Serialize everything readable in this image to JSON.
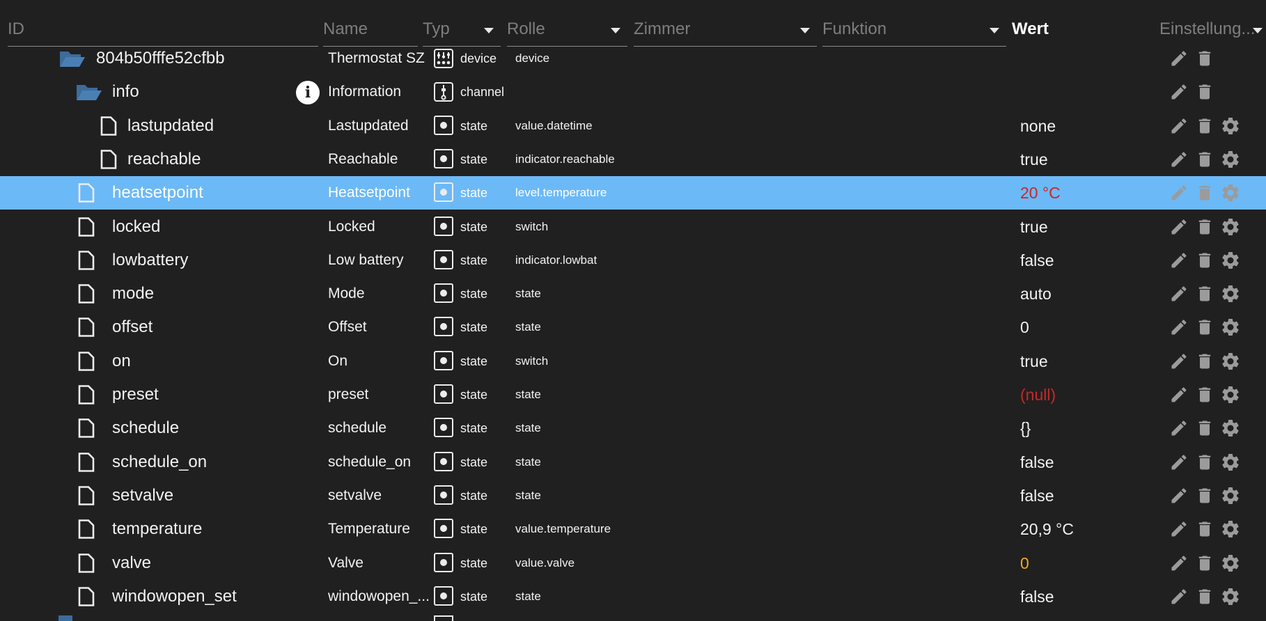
{
  "columns": {
    "id": "ID",
    "name": "Name",
    "typ": "Typ",
    "rolle": "Rolle",
    "zimmer": "Zimmer",
    "funktion": "Funktion",
    "wert": "Wert",
    "einstellung": "Einstellung..."
  },
  "rows": [
    {
      "id": "804b50fffe52cfbb",
      "name": "Thermostat SZ",
      "type": "device",
      "role": "device",
      "value": "",
      "icon": "folder-open-icon",
      "level": 0,
      "actions": [
        "edit-icon",
        "delete-icon"
      ]
    },
    {
      "id": "info",
      "name": "Information",
      "type": "channel",
      "role": "",
      "value": "",
      "icon": "folder-open-icon",
      "level": 1,
      "info_icon": "info-icon",
      "actions": [
        "edit-icon",
        "delete-icon"
      ]
    },
    {
      "id": "lastupdated",
      "name": "Lastupdated",
      "type": "state",
      "role": "value.datetime",
      "value": "none",
      "icon": "file-icon",
      "level": 2,
      "actions": [
        "edit-icon",
        "delete-icon",
        "gear-icon"
      ]
    },
    {
      "id": "reachable",
      "name": "Reachable",
      "type": "state",
      "role": "indicator.reachable",
      "value": "true",
      "icon": "file-icon",
      "level": 2,
      "actions": [
        "edit-icon",
        "delete-icon",
        "gear-icon"
      ]
    },
    {
      "id": "heatsetpoint",
      "name": "Heatsetpoint",
      "type": "state",
      "role": "level.temperature",
      "value": "20 °C",
      "value_color": "red",
      "selected": true,
      "icon": "file-icon",
      "level": 1,
      "actions": [
        "edit-icon",
        "delete-icon",
        "gear-icon"
      ]
    },
    {
      "id": "locked",
      "name": "Locked",
      "type": "state",
      "role": "switch",
      "value": "true",
      "icon": "file-icon",
      "level": 1,
      "actions": [
        "edit-icon",
        "delete-icon",
        "gear-icon"
      ]
    },
    {
      "id": "lowbattery",
      "name": "Low battery",
      "type": "state",
      "role": "indicator.lowbat",
      "value": "false",
      "icon": "file-icon",
      "level": 1,
      "actions": [
        "edit-icon",
        "delete-icon",
        "gear-icon"
      ]
    },
    {
      "id": "mode",
      "name": "Mode",
      "type": "state",
      "role": "state",
      "value": "auto",
      "icon": "file-icon",
      "level": 1,
      "actions": [
        "edit-icon",
        "delete-icon",
        "gear-icon"
      ]
    },
    {
      "id": "offset",
      "name": "Offset",
      "type": "state",
      "role": "state",
      "value": "0",
      "icon": "file-icon",
      "level": 1,
      "actions": [
        "edit-icon",
        "delete-icon",
        "gear-icon"
      ]
    },
    {
      "id": "on",
      "name": "On",
      "type": "state",
      "role": "switch",
      "value": "true",
      "icon": "file-icon",
      "level": 1,
      "actions": [
        "edit-icon",
        "delete-icon",
        "gear-icon"
      ]
    },
    {
      "id": "preset",
      "name": "preset",
      "type": "state",
      "role": "state",
      "value": "(null)",
      "value_color": "red",
      "icon": "file-icon",
      "level": 1,
      "actions": [
        "edit-icon",
        "delete-icon",
        "gear-icon"
      ]
    },
    {
      "id": "schedule",
      "name": "schedule",
      "type": "state",
      "role": "state",
      "value": "{}",
      "icon": "file-icon",
      "level": 1,
      "actions": [
        "edit-icon",
        "delete-icon",
        "gear-icon"
      ]
    },
    {
      "id": "schedule_on",
      "name": "schedule_on",
      "type": "state",
      "role": "state",
      "value": "false",
      "icon": "file-icon",
      "level": 1,
      "actions": [
        "edit-icon",
        "delete-icon",
        "gear-icon"
      ]
    },
    {
      "id": "setvalve",
      "name": "setvalve",
      "type": "state",
      "role": "state",
      "value": "false",
      "icon": "file-icon",
      "level": 1,
      "actions": [
        "edit-icon",
        "delete-icon",
        "gear-icon"
      ]
    },
    {
      "id": "temperature",
      "name": "Temperature",
      "type": "state",
      "role": "value.temperature",
      "value": "20,9 °C",
      "icon": "file-icon",
      "level": 1,
      "actions": [
        "edit-icon",
        "delete-icon",
        "gear-icon"
      ]
    },
    {
      "id": "valve",
      "name": "Valve",
      "type": "state",
      "role": "value.valve",
      "value": "0",
      "value_color": "orange",
      "icon": "file-icon",
      "level": 1,
      "actions": [
        "edit-icon",
        "delete-icon",
        "gear-icon"
      ]
    },
    {
      "id": "windowopen_set",
      "name": "windowopen_...",
      "type": "state",
      "role": "state",
      "value": "false",
      "icon": "file-icon",
      "level": 1,
      "actions": [
        "edit-icon",
        "delete-icon",
        "gear-icon"
      ]
    }
  ],
  "colors": {
    "background": "#202020",
    "selected_row": "#6cb9f7",
    "folder": "#3d6b9a",
    "value_red": "#c62828",
    "value_orange": "#f5a623"
  }
}
